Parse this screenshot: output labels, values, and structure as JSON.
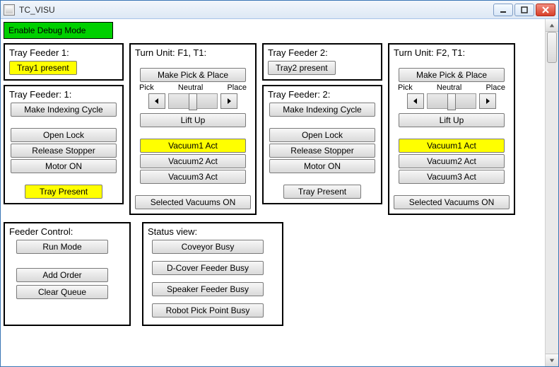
{
  "window": {
    "title": "TC_VISU"
  },
  "top": {
    "debug_label": "Enable Debug Mode"
  },
  "feeder1": {
    "header_title": "Tray Feeder 1:",
    "tray_present_top": "Tray1 present",
    "panel_title": "Tray Feeder: 1:",
    "btn_index": "Make Indexing Cycle",
    "btn_open": "Open Lock",
    "btn_release": "Release Stopper",
    "btn_motor": "Motor ON",
    "btn_tray_present": "Tray Present"
  },
  "turnunit1": {
    "title": "Turn Unit: F1, T1:",
    "btn_pickplace": "Make Pick & Place",
    "label_pick": "Pick",
    "label_neutral": "Neutral",
    "label_place": "Place",
    "btn_lift": "Lift Up",
    "btn_vac1": "Vacuum1 Act",
    "btn_vac2": "Vacuum2 Act",
    "btn_vac3": "Vacuum3 Act",
    "btn_vac_sel": "Selected Vacuums ON"
  },
  "feeder2": {
    "header_title": "Tray Feeder 2:",
    "tray_present_top": "Tray2 present",
    "panel_title": "Tray Feeder: 2:",
    "btn_index": "Make Indexing Cycle",
    "btn_open": "Open Lock",
    "btn_release": "Release Stopper",
    "btn_motor": "Motor ON",
    "btn_tray_present": "Tray Present"
  },
  "turnunit2": {
    "title": "Turn Unit: F2, T1:",
    "btn_pickplace": "Make Pick & Place",
    "label_pick": "Pick",
    "label_neutral": "Neutral",
    "label_place": "Place",
    "btn_lift": "Lift Up",
    "btn_vac1": "Vacuum1 Act",
    "btn_vac2": "Vacuum2 Act",
    "btn_vac3": "Vacuum3 Act",
    "btn_vac_sel": "Selected Vacuums ON"
  },
  "feeder_control": {
    "title": "Feeder Control:",
    "btn_run": "Run Mode",
    "btn_add": "Add Order",
    "btn_clear": "Clear Queue"
  },
  "status_view": {
    "title": "Status view:",
    "btn_conveyor": "Coveyor Busy",
    "btn_dcover": "D-Cover Feeder Busy",
    "btn_speaker": "Speaker Feeder Busy",
    "btn_robot": "Robot Pick Point Busy"
  }
}
